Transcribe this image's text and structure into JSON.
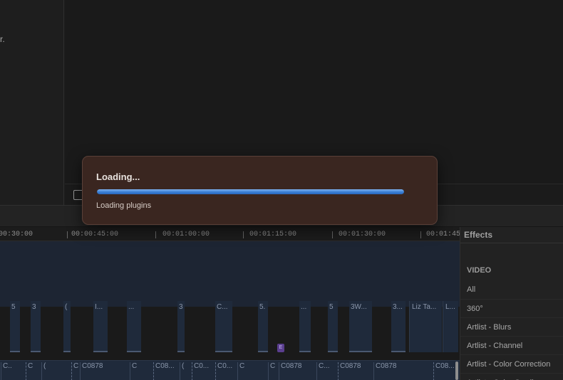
{
  "left_panel": {
    "text": "r."
  },
  "timeline": {
    "ruler_ticks": [
      "00:30:00",
      "00:00:45:00",
      "00:01:00:00",
      "00:01:15:00",
      "00:01:30:00",
      "00:01:45"
    ],
    "clips": [
      {
        "label": "5"
      },
      {
        "label": "3"
      },
      {
        "label": "("
      },
      {
        "label": "I..."
      },
      {
        "label": "..."
      },
      {
        "label": "3"
      },
      {
        "label": "C..."
      },
      {
        "label": "5."
      },
      {
        "label": "..."
      },
      {
        "label": "5"
      },
      {
        "label": "3W..."
      },
      {
        "label": "3..."
      },
      {
        "label": "Liz Ta..."
      },
      {
        "label": "L..."
      }
    ],
    "marker_label": "E",
    "bottom_clips": [
      "C..",
      "C",
      "(",
      "C",
      "C0878",
      "C",
      "C08...",
      "(",
      "C0...",
      "C0...",
      "C",
      "C",
      "C0878",
      "C...",
      "C0878",
      "C0878",
      "C08..."
    ]
  },
  "effects": {
    "title": "Effects",
    "section": "VIDEO",
    "items": [
      "All",
      "360°",
      "Artlist - Blurs",
      "Artlist - Channel",
      "Artlist - Color Correction",
      "Artlist - Color Grading"
    ]
  },
  "dialog": {
    "title": "Loading...",
    "status": "Loading plugins",
    "progress": 1.0,
    "accent_color": "#3a7fd5",
    "background_color": "#3a2620"
  }
}
